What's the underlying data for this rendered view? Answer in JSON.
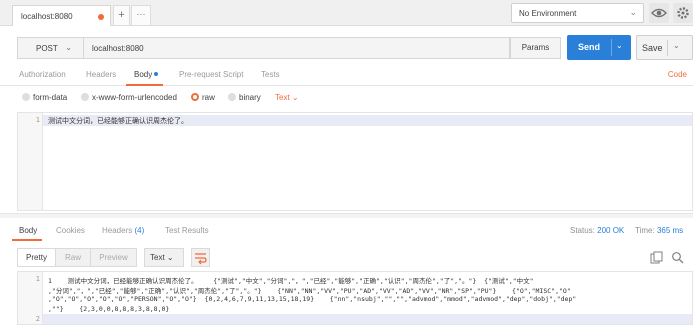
{
  "top_tabs": {
    "request_tab": "localhost:8080",
    "new_tab": "+",
    "more": "···"
  },
  "environment": {
    "selected": "No Environment"
  },
  "request": {
    "method": "POST",
    "url": "localhost:8080",
    "params_label": "Params",
    "send_label": "Send",
    "save_label": "Save"
  },
  "request_tabs": {
    "items": [
      "Authorization",
      "Headers",
      "Body",
      "Pre-request Script",
      "Tests"
    ],
    "active": "Body",
    "code_link": "Code"
  },
  "body_types": {
    "items": [
      "form-data",
      "x-www-form-urlencoded",
      "raw",
      "binary"
    ],
    "selected": "raw",
    "text_type": "Text"
  },
  "request_body": {
    "line_number": "1",
    "text": "测试中文分词，已经能够正确认识周杰伦了。"
  },
  "response_tabs": {
    "items": [
      "Body",
      "Cookies",
      "Headers",
      "Test Results"
    ],
    "headers_count": "(4)",
    "active": "Body"
  },
  "response_meta": {
    "status_label": "Status:",
    "status_value": "200 OK",
    "time_label": "Time:",
    "time_value": "365 ms"
  },
  "response_toolbar": {
    "views": [
      "Pretty",
      "Raw",
      "Preview"
    ],
    "active_view": "Pretty",
    "format": "Text"
  },
  "response_body": {
    "line_numbers": [
      "1",
      "",
      "",
      "",
      "2"
    ],
    "lines": [
      "1    测试中文分词，已经能够正确认识周杰伦了。    {\"测试\",\"中文\",\"分词\",\"，\",\"已经\",\"能够\",\"正确\",\"认识\",\"周杰伦\",\"了\",\"。\"}  {\"测试\",\"中文\"",
      ",\"分词\",\"，\",\"已经\",\"能够\",\"正确\",\"认识\",\"周杰伦\",\"了\",\"。\"}    {\"NN\",\"NN\",\"VV\",\"PU\",\"AD\",\"VV\",\"AD\",\"VV\",\"NR\",\"SP\",\"PU\"}    {\"O\",\"MISC\",\"O\"",
      ",\"O\",\"O\",\"O\",\"O\",\"O\",\"PERSON\",\"O\",\"O\"}  {0,2,4,6,7,9,11,13,15,18,19}    {\"nn\",\"nsubj\",\"\",\"\",\"advmod\",\"mmod\",\"advmod\",\"dep\",\"dobj\",\"dep\"",
      ",\"\"}    {2,3,0,0,8,8,8,3,8,8,0}",
      ""
    ]
  },
  "colors": {
    "accent": "#f26b3a",
    "primary": "#2a7fd8"
  }
}
